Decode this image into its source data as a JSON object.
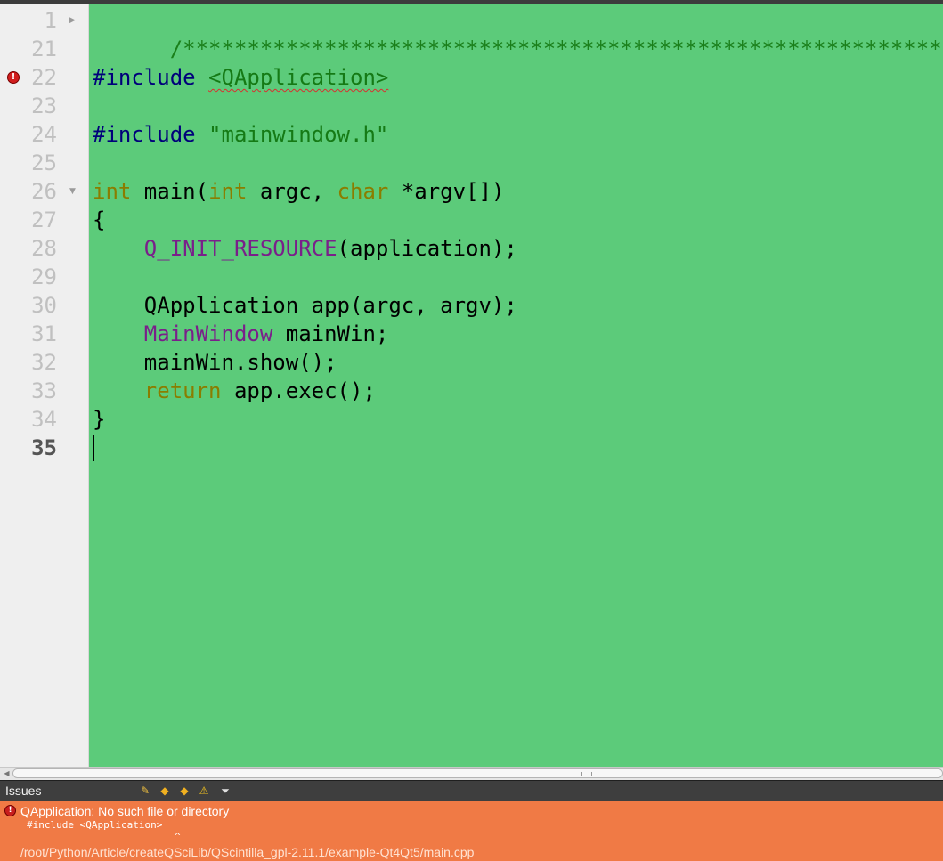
{
  "editor": {
    "colors": {
      "background": "#5ccb7a",
      "gutter": "#efefef",
      "comment": "#1a7f1a",
      "preprocessor": "#00007a",
      "string": "#157a15",
      "keyword": "#8a7d00",
      "macro": "#7a1f8a"
    },
    "current_line": "35",
    "line_numbers": [
      "1",
      "21",
      "22",
      "23",
      "24",
      "25",
      "26",
      "27",
      "28",
      "29",
      "30",
      "31",
      "32",
      "33",
      "34",
      "35"
    ],
    "lines": {
      "l1_comment": "/*************************************************************************",
      "l22_include": "#include",
      "l22_header": "<QApplication>",
      "l24_include": "#include",
      "l24_header": "\"mainwindow.h\"",
      "l26_int1": "int",
      "l26_main": " main(",
      "l26_int2": "int",
      "l26_argc": " argc, ",
      "l26_char": "char",
      "l26_argv": " *argv[])",
      "l27_brace": "{",
      "l28_macro": "Q_INIT_RESOURCE",
      "l28_args": "(application);",
      "l30_code": "QApplication app(argc, argv);",
      "l31_type": "MainWindow",
      "l31_var": " mainWin;",
      "l32_code": "mainWin.show();",
      "l33_return": "return",
      "l33_code": " app.exec();",
      "l34_brace": "}"
    }
  },
  "icons": {
    "fold_collapsed": "fold-collapsed-icon",
    "fold_expanded": "fold-expanded-icon",
    "error_marker": "error-icon"
  },
  "issues": {
    "title": "Issues",
    "toolbar": [
      "clear-issues-icon",
      "previous-item-icon",
      "next-item-icon",
      "warning-filter-icon",
      "filter-icon"
    ],
    "colors": {
      "panel_background": "#f07a45",
      "bar_background": "#3e3e3e"
    },
    "items": [
      {
        "message": "QApplication: No such file or directory",
        "code_line": "#include <QApplication>",
        "caret": "^",
        "path": "/root/Python/Article/createQSciLib/QScintilla_gpl-2.11.1/example-Qt4Qt5/main.cpp"
      }
    ]
  }
}
